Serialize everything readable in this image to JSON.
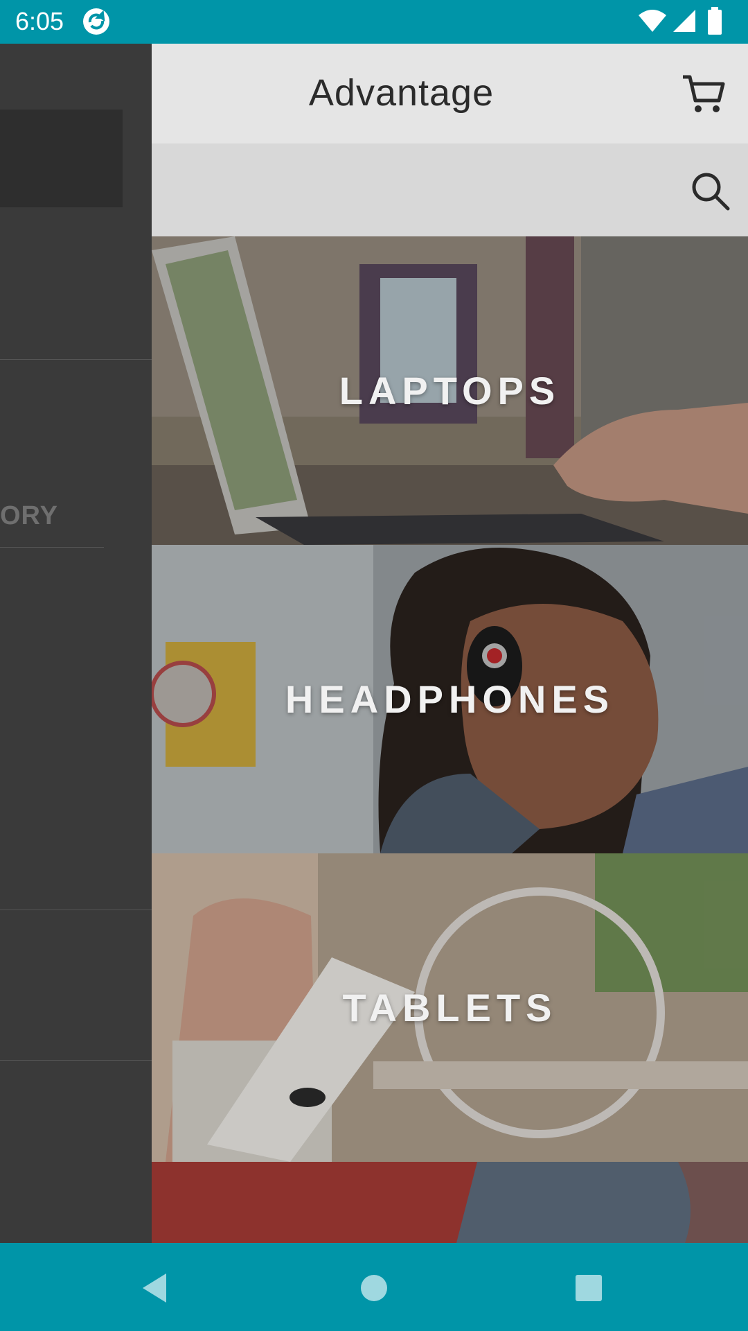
{
  "status_bar": {
    "time": "6:05",
    "icons": [
      "app-sync-icon",
      "wifi-icon",
      "cellular-signal-icon",
      "battery-icon"
    ]
  },
  "drawer": {
    "partial_item_label": "ORY"
  },
  "toolbar": {
    "title": "Advantage",
    "cart_icon": "cart-icon"
  },
  "search": {
    "icon": "search-icon"
  },
  "categories": [
    {
      "label": "LAPTOPS"
    },
    {
      "label": "HEADPHONES"
    },
    {
      "label": "TABLETS"
    }
  ],
  "nav_bar": {
    "buttons": [
      "back-icon",
      "home-icon",
      "recents-icon"
    ]
  },
  "colors": {
    "accent": "#0095a8",
    "drawer": "#3a3a3a",
    "toolbar": "#e5e5e5"
  }
}
